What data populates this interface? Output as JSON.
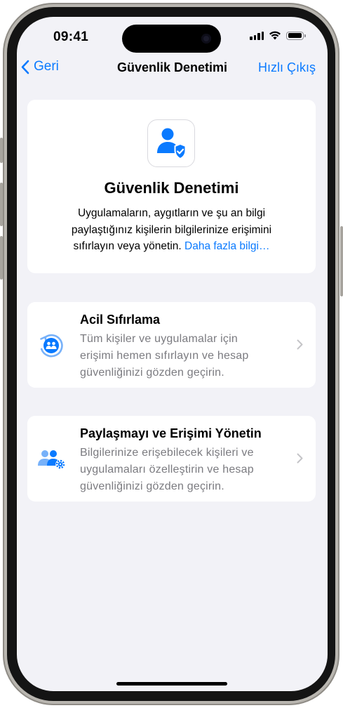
{
  "status_bar": {
    "time": "09:41"
  },
  "nav": {
    "back_label": "Geri",
    "title": "Güvenlik Denetimi",
    "quick_exit": "Hızlı Çıkış"
  },
  "hero": {
    "icon": "person-shield-icon",
    "title": "Güvenlik Denetimi",
    "line1": "Uygulamaların, aygıtların ve şu an bilgi",
    "line2": "paylaştığınız kişilerin bilgilerinize erişimini",
    "line3": "sıfırlayın veya yönetin.",
    "link": "Daha fazla bilgi…"
  },
  "options": [
    {
      "icon": "emergency-reset-icon",
      "title": "Acil Sıfırlama",
      "line1": "Tüm kişiler ve uygulamalar için",
      "line2": "erişimi hemen sıfırlayın ve hesap",
      "line3": "güvenliğinizi gözden geçirin."
    },
    {
      "icon": "manage-sharing-icon",
      "title": "Paylaşmayı ve Erişimi Yönetin",
      "line1": "Bilgilerinize erişebilecek kişileri ve",
      "line2": "uygulamaları özelleştirin ve hesap",
      "line3": "güvenliğinizi gözden geçirin."
    }
  ],
  "colors": {
    "accent": "#0a7aff",
    "background": "#f2f2f7",
    "secondary_text": "#7b7b80"
  }
}
